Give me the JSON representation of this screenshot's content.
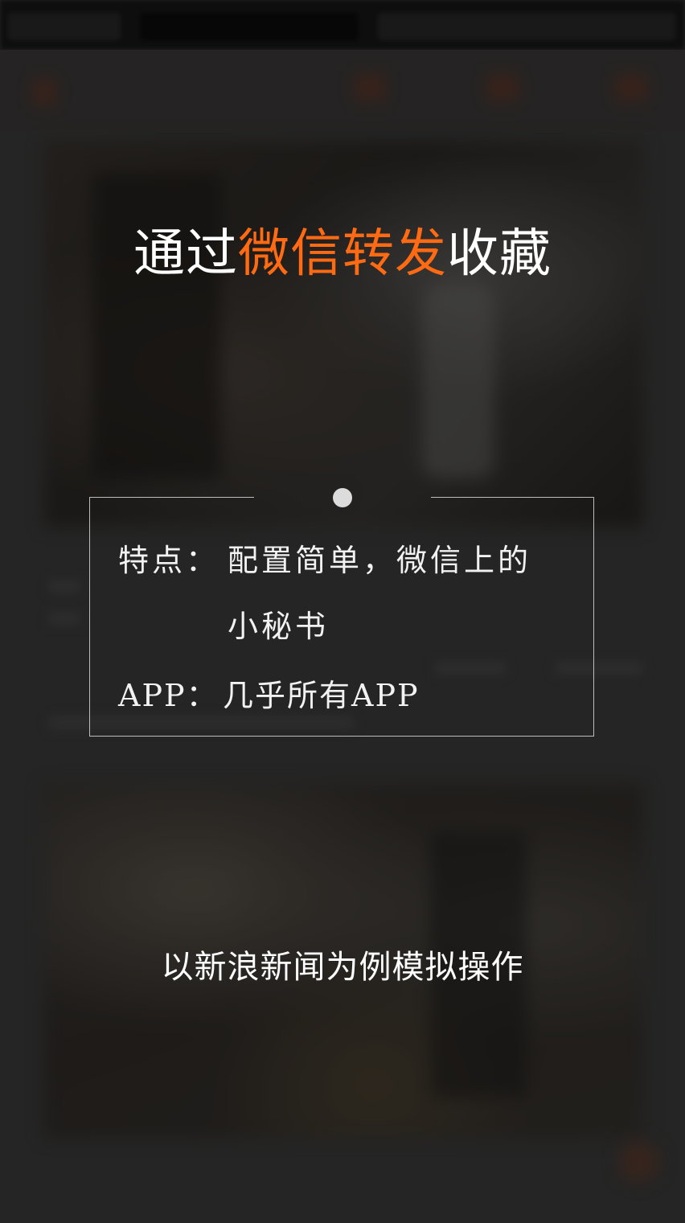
{
  "headline": {
    "prefix": "通过",
    "highlight": "微信转发",
    "suffix": "收藏",
    "highlight_color": "#ff6a13"
  },
  "info": {
    "feature_label": "特点：",
    "feature_value_line1": "配置简单，微信上的",
    "feature_value_line2": "小秘书",
    "app_label": "APP：",
    "app_value": "几乎所有APP"
  },
  "caption": "以新浪新闻为例模拟操作",
  "icons": {
    "dot": "bullet-dot-icon"
  }
}
